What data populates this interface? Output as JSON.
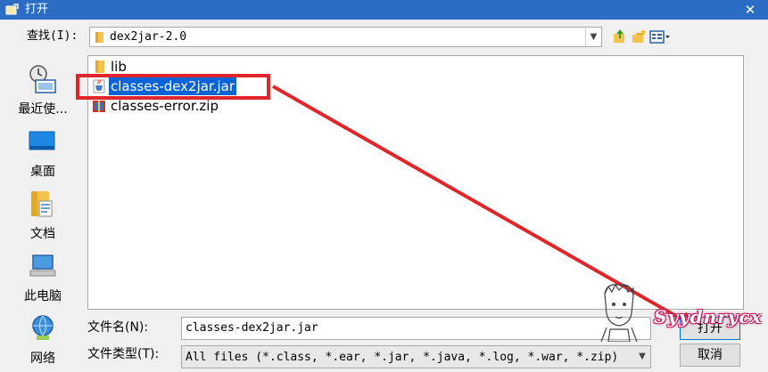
{
  "titlebar": {
    "title": "打开",
    "close_symbol": "✕"
  },
  "lookin": {
    "label": "查找(I):",
    "value": "dex2jar-2.0"
  },
  "toolbar_icons": [
    "up-folder-icon",
    "new-folder-icon",
    "view-menu-icon"
  ],
  "places": [
    {
      "label": "最近使...",
      "icon": "recent-icon"
    },
    {
      "label": "桌面",
      "icon": "desktop-icon"
    },
    {
      "label": "文档",
      "icon": "documents-icon"
    },
    {
      "label": "此电脑",
      "icon": "computer-icon"
    },
    {
      "label": "网络",
      "icon": "network-icon"
    }
  ],
  "files": [
    {
      "name": "lib",
      "icon": "folder-icon"
    },
    {
      "name": "classes-dex2jar.jar",
      "icon": "jar-file-icon",
      "selected": true
    },
    {
      "name": "classes-error.zip",
      "icon": "zip-file-icon"
    }
  ],
  "filename": {
    "label": "文件名(N):",
    "value": "classes-dex2jar.jar"
  },
  "filetype": {
    "label": "文件类型(T):",
    "value": "All files (*.class, *.ear, *.jar, *.java, *.log, *.war, *.zip)"
  },
  "buttons": {
    "open": "打开",
    "cancel": "取消"
  },
  "watermark": "Syydnrycx",
  "colors": {
    "titlebar": "#2b6cc4",
    "selection": "#0a64d6",
    "annotation": "#e0262b"
  }
}
